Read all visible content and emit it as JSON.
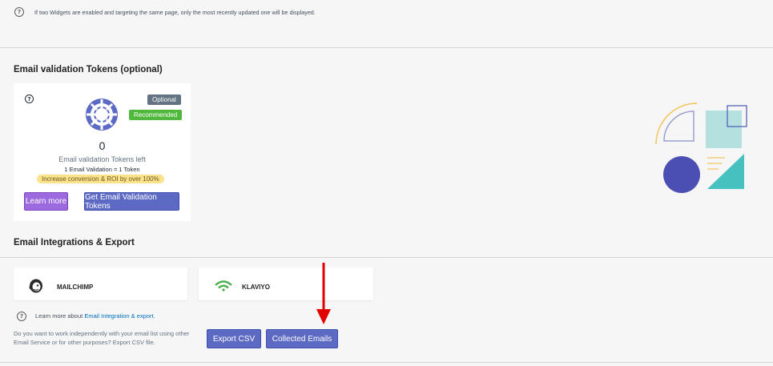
{
  "notice": {
    "text": "If two Widgets are enabled and targeting the same page, only the most recently updated one will be displayed.",
    "icon": "question-circle-icon"
  },
  "tokens": {
    "section_title": "Email validation Tokens (optional)",
    "optional_badge": "Optional",
    "recommended_badge": "Recommended",
    "count": "0",
    "count_label": "Email validation Tokens left",
    "rate": "1 Email Validation = 1 Token",
    "promo": "Increase conversion & ROI by over 100%",
    "learn_more_button": "Learn more",
    "get_tokens_button": "Get Email Validation Tokens",
    "icon": "lifebuoy-icon"
  },
  "integrations": {
    "section_title": "Email Integrations & Export",
    "items": [
      {
        "name": "MAILCHIMP",
        "icon": "mailchimp-icon"
      },
      {
        "name": "KLAVIYO",
        "icon": "klaviyo-icon"
      }
    ],
    "learn_prefix": "Learn more about",
    "learn_link": "Email Integration & export.",
    "export_desc": "Do you want to work independently with your email list using other Email Service or for other purposes? Export CSV file.",
    "export_csv_button": "Export CSV",
    "collected_emails_button": "Collected Emails"
  },
  "colors": {
    "primary_button": "#5c6ac4",
    "learn_more_button": "#9c6ade",
    "optional_badge": "#637381",
    "recommended_badge": "#50b83c",
    "promo_bg": "#fbe28d",
    "lifebuoy": "#5c6ac4",
    "annotation_arrow": "#e00000"
  }
}
